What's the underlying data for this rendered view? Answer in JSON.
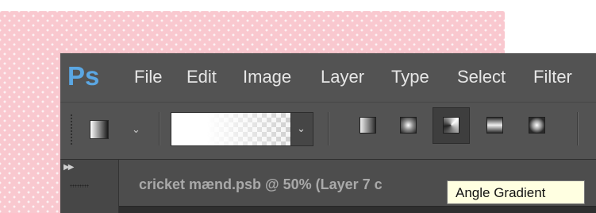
{
  "app": {
    "logo": "Ps"
  },
  "menu": {
    "items": [
      "File",
      "Edit",
      "Image",
      "Layer",
      "Type",
      "Select",
      "Filter"
    ]
  },
  "options_bar": {
    "tool_preset_icon": "gradient-tool-preset-icon",
    "gradient_picker_icon": "gradient-picker-swatch",
    "gradient_types": [
      {
        "name": "Linear Gradient",
        "icon": "linear-gradient-icon"
      },
      {
        "name": "Radial Gradient",
        "icon": "radial-gradient-icon"
      },
      {
        "name": "Angle Gradient",
        "icon": "angle-gradient-icon",
        "active": true
      },
      {
        "name": "Reflected Gradient",
        "icon": "reflected-gradient-icon"
      },
      {
        "name": "Diamond Gradient",
        "icon": "diamond-gradient-icon"
      }
    ]
  },
  "document": {
    "tab_title": "cricket mænd.psb @ 50% (Layer 7 c"
  },
  "tooltip": {
    "text": "Angle Gradient"
  },
  "colors": {
    "ps_blue": "#5ba7e3",
    "ui_dark": "#535353",
    "tooltip_bg": "#ffffe1",
    "pink_bg": "#f9c8cf"
  }
}
